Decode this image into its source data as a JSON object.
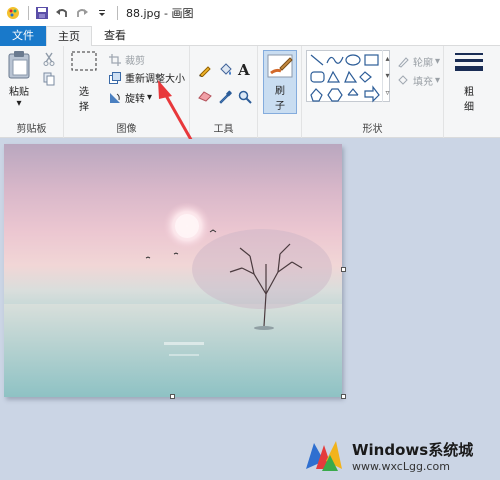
{
  "titlebar": {
    "title": "88.jpg - 画图"
  },
  "tabs": {
    "file": "文件",
    "home": "主页",
    "view": "查看"
  },
  "ribbon": {
    "clipboard": {
      "paste": "粘贴",
      "label": "剪贴板"
    },
    "image": {
      "select_top": "选",
      "select_bottom": "择",
      "crop": "裁剪",
      "resize": "重新调整大小",
      "rotate": "旋转",
      "label": "图像"
    },
    "tools": {
      "label": "工具"
    },
    "brushes": {
      "top": "刷",
      "bottom": "子"
    },
    "shapes": {
      "outline": "轮廓",
      "fill": "填充",
      "label": "形状"
    },
    "size": {
      "top": "粗",
      "bottom": "细"
    }
  },
  "watermark": {
    "title": "Windows系统城",
    "url": "www.wxcLgg.com"
  },
  "colors": {
    "accent": "#1979ca",
    "arrow": "#e8383b",
    "ribbon_bg": "#f5f6f7",
    "workspace_bg": "#cbd5e5"
  }
}
